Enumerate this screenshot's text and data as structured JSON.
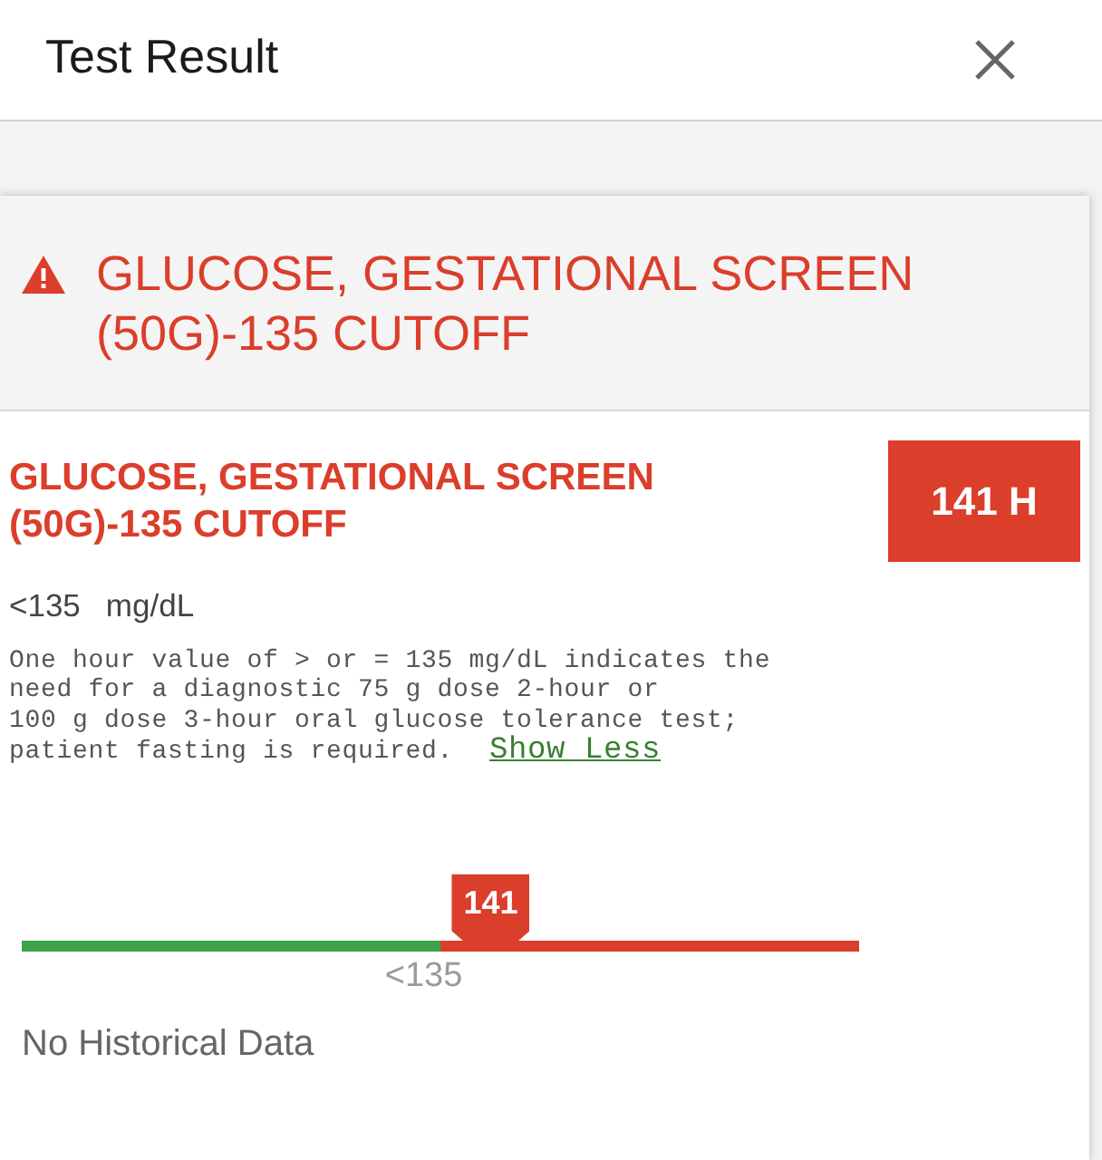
{
  "header": {
    "title": "Test Result"
  },
  "result": {
    "abnormal": true,
    "banner_title": "GLUCOSE, GESTATIONAL SCREEN (50G)-135 CUTOFF",
    "test_name": "GLUCOSE, GESTATIONAL SCREEN (50G)-135 CUTOFF",
    "value_badge": "141 H",
    "reference_range": "<135",
    "unit": "mg/dL",
    "description": "One hour value of > or = 135 mg/dL indicates the\nneed for a diagnostic 75 g dose 2-hour or\n100 g dose 3-hour oral glucose tolerance test;\npatient fasting is required.",
    "toggle_link": "Show Less",
    "range_bar": {
      "marker": "141",
      "level": 0.56,
      "threshold_label": "<135"
    }
  },
  "history": {
    "message": "No Historical Data"
  }
}
